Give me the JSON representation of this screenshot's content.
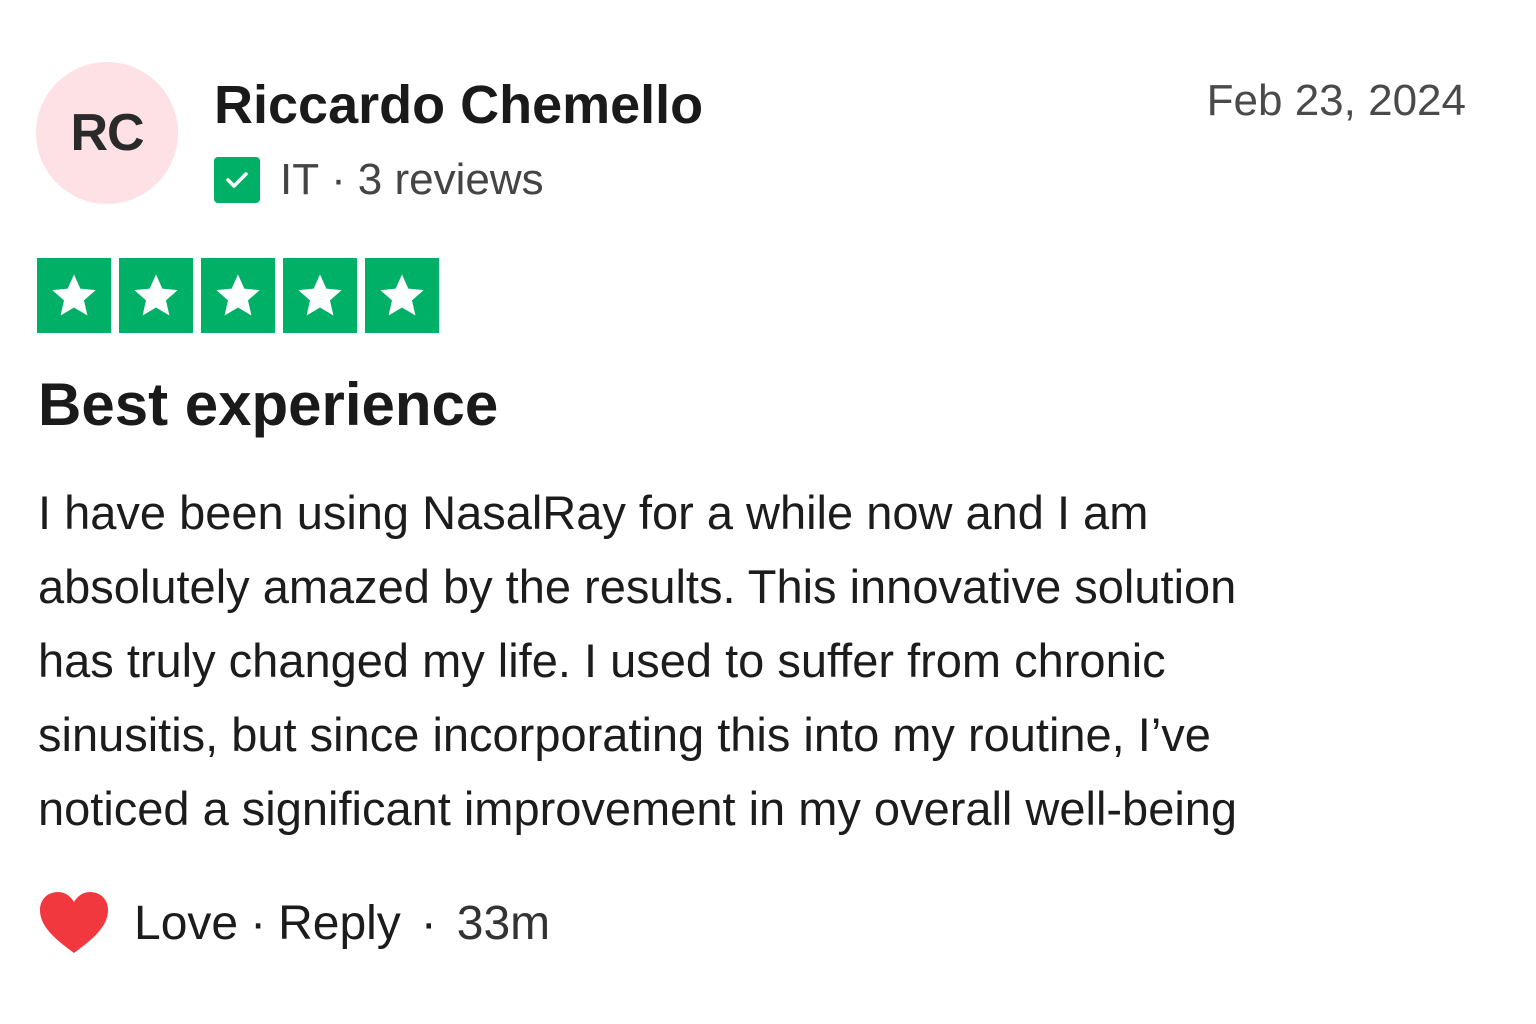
{
  "reviewer": {
    "initials": "RC",
    "name": "Riccardo Chemello",
    "country": "IT",
    "separator": "·",
    "review_count": "3 reviews",
    "avatar_color": "#fde1e4",
    "verified_icon": "check-icon"
  },
  "review": {
    "date": "Feb 23, 2024",
    "rating": 5,
    "rating_max": 5,
    "star_color": "#00b067",
    "title": "Best experience",
    "body_lines": [
      "I have been using NasalRay for a while now and I am",
      "absolutely amazed by the results. This innovative solution",
      "has truly changed my life. I used to suffer from chronic",
      "sinusitis, but since incorporating this into my routine, I’ve",
      "noticed a significant improvement in my overall well-being"
    ]
  },
  "actions": {
    "love_label": "Love",
    "separator": "·",
    "reply_label": "Reply",
    "time_ago": "33m",
    "heart_color": "#f0383e"
  }
}
